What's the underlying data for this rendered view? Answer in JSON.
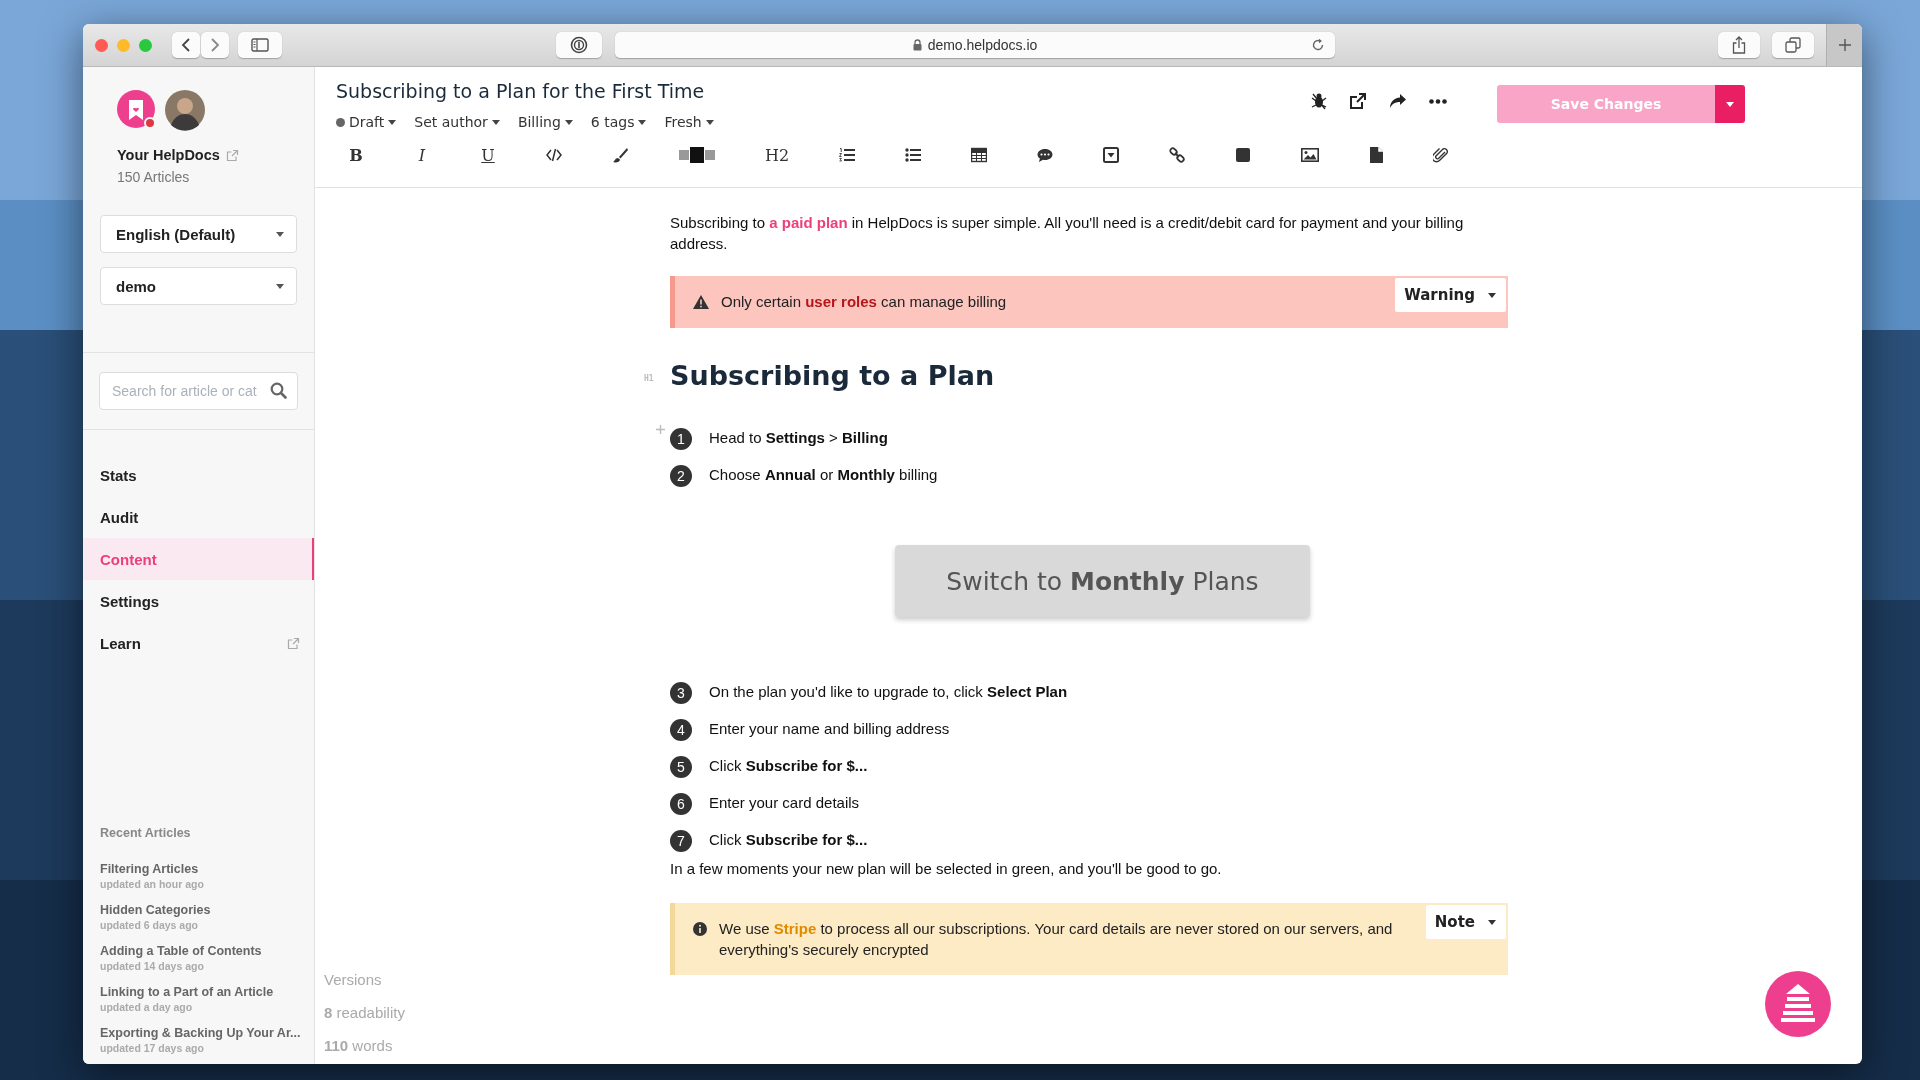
{
  "browser": {
    "url": "demo.helpdocs.io"
  },
  "sidebar": {
    "brand": {
      "name": "Your HelpDocs",
      "count": "150 Articles"
    },
    "selects": [
      {
        "value": "English (Default)"
      },
      {
        "value": "demo"
      }
    ],
    "search": {
      "placeholder": "Search for article or cat"
    },
    "nav": [
      {
        "label": "Stats",
        "selected": false,
        "external": false
      },
      {
        "label": "Audit",
        "selected": false,
        "external": false
      },
      {
        "label": "Content",
        "selected": true,
        "external": false
      },
      {
        "label": "Settings",
        "selected": false,
        "external": false
      },
      {
        "label": "Learn",
        "selected": false,
        "external": true
      }
    ],
    "recent_title": "Recent Articles",
    "recent": [
      {
        "title": "Filtering Articles",
        "updated": "updated an hour ago"
      },
      {
        "title": "Hidden Categories",
        "updated": "updated 6 days ago"
      },
      {
        "title": "Adding a Table of Contents",
        "updated": "updated 14 days ago"
      },
      {
        "title": "Linking to a Part of an Article",
        "updated": "updated a day ago"
      },
      {
        "title": "Exporting & Backing Up Your Ar...",
        "updated": "updated 17 days ago"
      }
    ]
  },
  "editor": {
    "title": "Subscribing to a Plan for the First Time",
    "meta": [
      {
        "label": "Draft",
        "kind": "status"
      },
      {
        "label": "Set author",
        "kind": "menu"
      },
      {
        "label": "Billing",
        "kind": "menu"
      },
      {
        "label": "6 tags",
        "kind": "menu"
      },
      {
        "label": "Fresh",
        "kind": "menu"
      }
    ],
    "save": {
      "label": "Save Changes",
      "disabled": true
    },
    "format_glyphs": [
      "B",
      "I",
      "U",
      "H2"
    ]
  },
  "article": [
    {
      "kind": "paragraph",
      "text": "Subscribing to **a paid plan** in HelpDocs is super simple. All you'll need is a credit/debit card for payment and your billing address."
    },
    {
      "kind": "warning_callout",
      "text": "Only certain **user roles** can manage billing",
      "type_label": "Warning"
    },
    {
      "kind": "heading",
      "tag": "H1",
      "text": "Subscribing to a Plan"
    },
    {
      "kind": "step",
      "number": "1",
      "text": "Head to **Settings** > **Billing**",
      "hovered": true
    },
    {
      "kind": "step",
      "number": "2",
      "text": "Choose **Annual** or **Monthly** billing",
      "hovered": false
    },
    {
      "kind": "image_button",
      "text": "Switch to **Monthly** Plans"
    },
    {
      "kind": "step",
      "number": "3",
      "text": "On the plan you'd like to upgrade to, click **Select Plan**",
      "hovered": false
    },
    {
      "kind": "step",
      "number": "4",
      "text": "Enter your name and billing address",
      "hovered": false
    },
    {
      "kind": "step",
      "number": "5",
      "text": "Click **Subscribe for $...**",
      "hovered": false
    },
    {
      "kind": "step",
      "number": "6",
      "text": "Enter your card details",
      "hovered": false
    },
    {
      "kind": "step",
      "number": "7",
      "text": "Click **Subscribe for $...**",
      "hovered": false
    },
    {
      "kind": "paragraph",
      "text": "In a few moments your new plan will be selected in green, and you'll be good to go."
    },
    {
      "kind": "note_callout",
      "text": "We use **Stripe** to process all our subscriptions. Your card details are never stored on our servers, and everything's securely encrypted",
      "type_label": "Note"
    }
  ],
  "stats": [
    {
      "text": "Versions"
    },
    {
      "text": "**8** readability"
    },
    {
      "text": "**110** words"
    }
  ]
}
